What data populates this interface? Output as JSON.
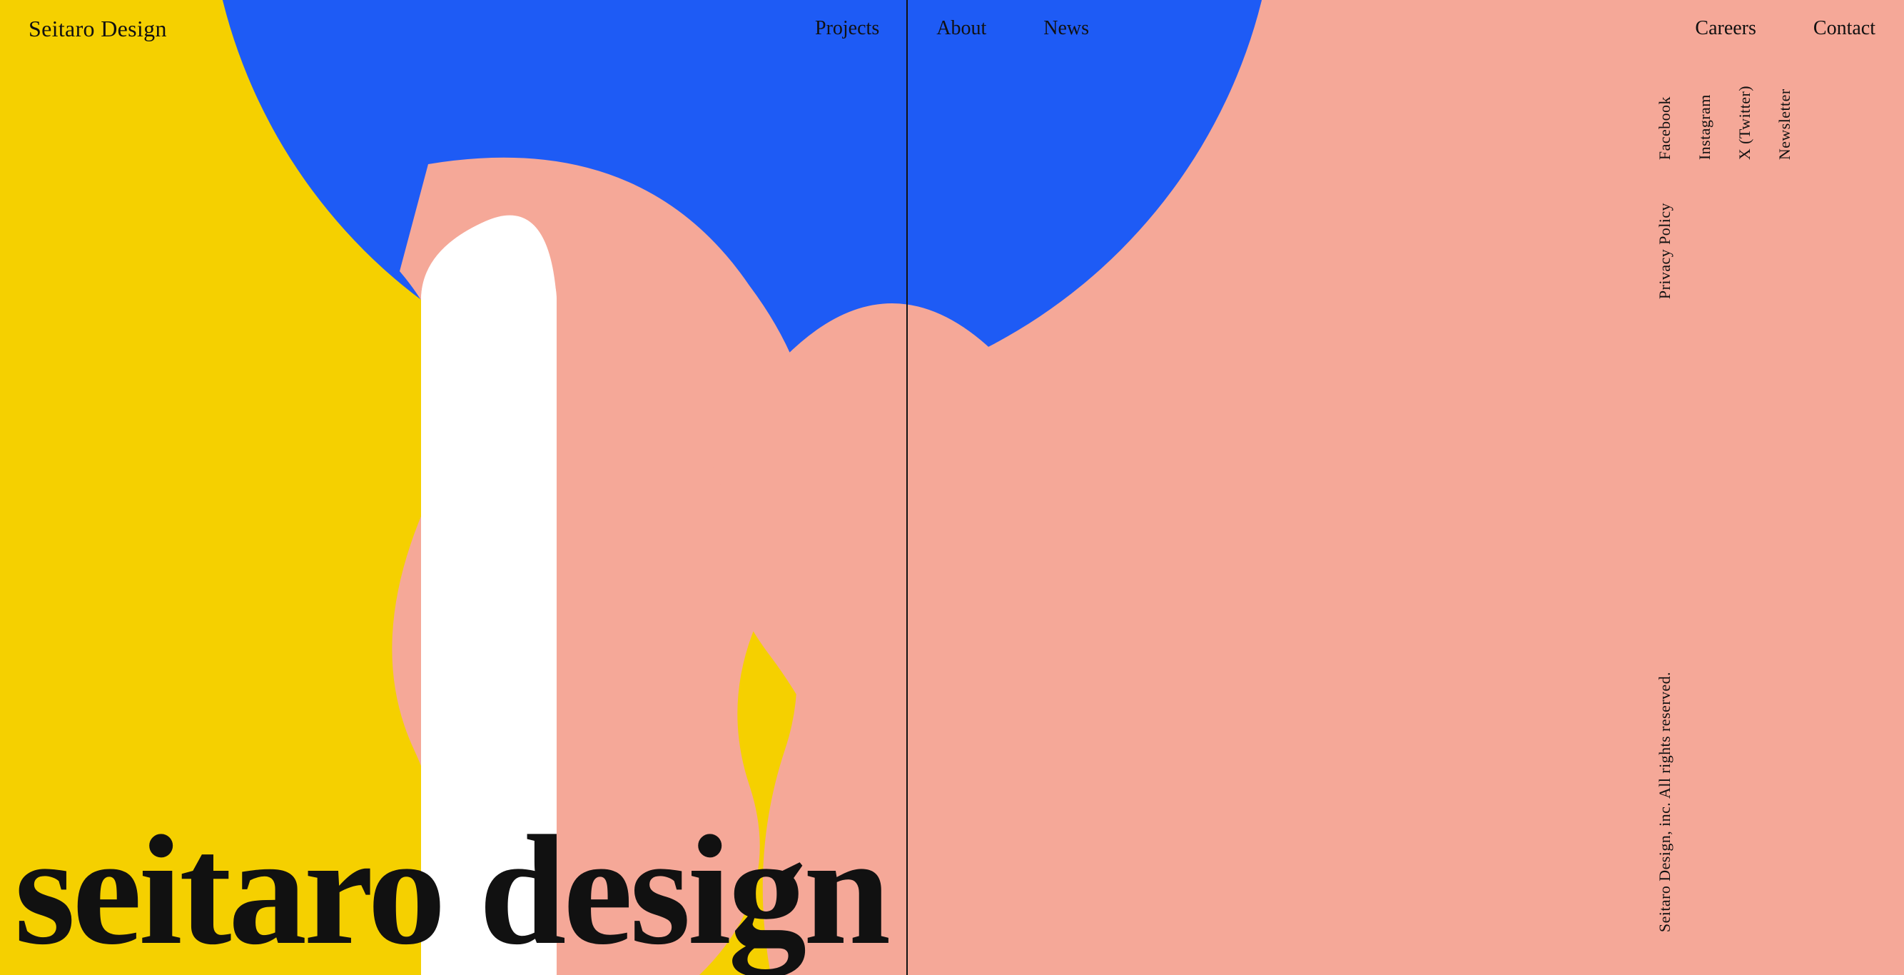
{
  "brand": {
    "logo": "Seitaro Design"
  },
  "nav": {
    "left_items": [
      {
        "label": "Projects",
        "href": "#"
      },
      {
        "label": "About",
        "href": "#"
      },
      {
        "label": "News",
        "href": "#"
      }
    ],
    "right_items": [
      {
        "label": "Careers",
        "href": "#"
      },
      {
        "label": "Contact",
        "href": "#"
      }
    ]
  },
  "sidebar": {
    "social_links": [
      {
        "label": "Facebook"
      },
      {
        "label": "Instagram"
      },
      {
        "label": "X (Twitter)"
      },
      {
        "label": "Newsletter"
      }
    ],
    "legal_links": [
      {
        "label": "Privacy Policy"
      }
    ],
    "copyright": "Seitaro Design, inc. All rights reserved."
  },
  "hero": {
    "text": "seitaro design"
  },
  "colors": {
    "yellow": "#F5D000",
    "blue": "#1E5BF5",
    "pink": "#F5A898",
    "white": "#FFFFFF",
    "black": "#111111"
  }
}
